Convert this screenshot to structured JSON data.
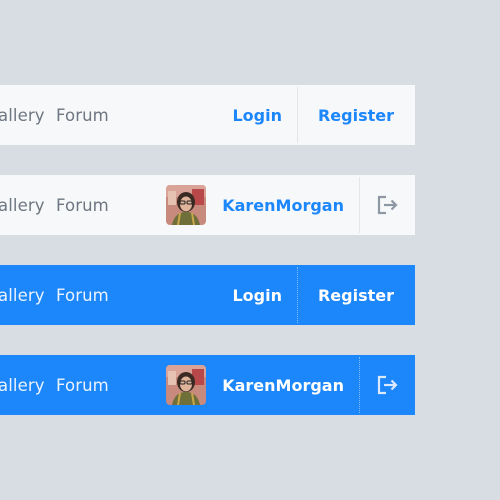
{
  "colors": {
    "background": "#d8dde4",
    "light_bar": "#f7f8f9",
    "blue_bar": "#1c86fb",
    "accent": "#1c86fb",
    "muted_text": "#6d7681"
  },
  "nav": {
    "gallery_label": "allery",
    "forum_label": "Forum"
  },
  "auth": {
    "login_label": "Login",
    "register_label": "Register"
  },
  "user": {
    "username": "KarenMorgan",
    "avatar_icon": "user-photo-avatar",
    "logout_icon": "logout-icon"
  },
  "variants": [
    {
      "theme": "light",
      "state": "logged-out"
    },
    {
      "theme": "light",
      "state": "logged-in"
    },
    {
      "theme": "blue",
      "state": "logged-out"
    },
    {
      "theme": "blue",
      "state": "logged-in"
    }
  ]
}
